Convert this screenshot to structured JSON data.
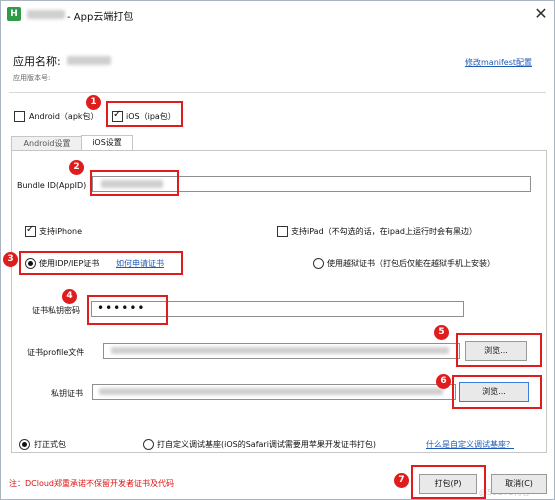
{
  "window": {
    "title": "- App云端打包",
    "close_symbol": "✕",
    "app_icon_text": "H"
  },
  "header": {
    "app_name_label": "应用名称:",
    "app_version_label": "应用版本号:",
    "modify_manifest_link": "修改manifest配置"
  },
  "platforms": {
    "android_label": "Android（apk包）",
    "android_checked": false,
    "ios_label": "iOS（ipa包）",
    "ios_checked": true
  },
  "tabs": [
    {
      "label": "Android设置",
      "active": false
    },
    {
      "label": "iOS设置",
      "active": true
    }
  ],
  "ios": {
    "bundle_id_label": "Bundle ID(AppID)",
    "support_iphone_label": "支持iPhone",
    "support_iphone_checked": true,
    "support_ipad_label": "支持iPad（不勾选的话，在ipad上运行时会有黑边）",
    "support_ipad_checked": false,
    "use_idp_label": "使用IDP/IEP证书",
    "how_to_apply_link": "如何申请证书",
    "use_jailbreak_label": "使用越狱证书（打包后仅能在越狱手机上安装）",
    "cert_password_label": "证书私钥密码",
    "cert_password_value": "••••••",
    "profile_label": "证书profile文件",
    "private_key_label": "私钥证书",
    "browse_label": "浏览..."
  },
  "package_type": {
    "formal_label": "打正式包",
    "formal_checked": true,
    "custom_debug_label": "打自定义调试基座(iOS的Safari调试需要用苹果开发证书打包)",
    "custom_debug_checked": false,
    "what_is_custom_link": "什么是自定义调试基座？"
  },
  "footer": {
    "warning": "注：DCloud郑重承诺不保留开发者证书及代码",
    "pack_button": "打包(P)",
    "cancel_button": "取消(C)",
    "watermark": "@51CTO博客"
  },
  "annotations": [
    "1",
    "2",
    "3",
    "4",
    "5",
    "6",
    "7"
  ],
  "colors": {
    "annotation_red": "#e01d1d",
    "link_blue": "#1f5bb6",
    "app_icon_green": "#2e9b47"
  }
}
